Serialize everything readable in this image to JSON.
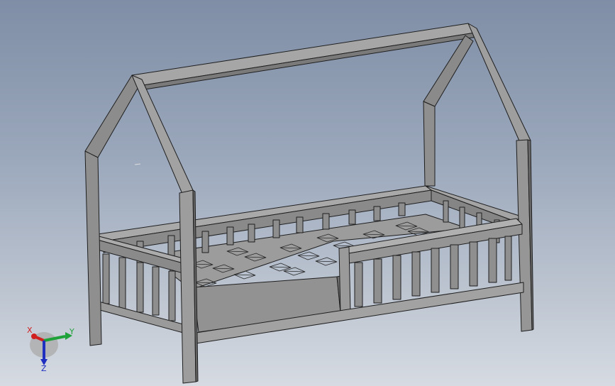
{
  "viewport": {
    "description_color_top": "#7f8ea6",
    "model_fill": "#9a9a9a",
    "model_dark": "#6c6c6c",
    "model_light": "#b4b4b4",
    "edge_color": "#1e1e1e"
  },
  "triad": {
    "x_label": "X",
    "y_label": "Y",
    "z_label": "Z",
    "x_color": "#d02020",
    "y_color": "#1fa23a",
    "z_color": "#1f2fbf"
  }
}
